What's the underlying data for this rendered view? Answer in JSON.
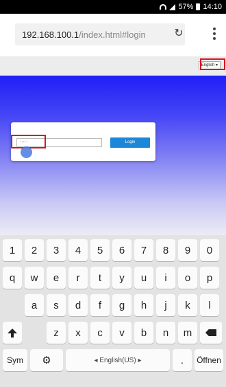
{
  "status_bar": {
    "battery": "57%",
    "time": "14:10"
  },
  "browser": {
    "url_host": "192.168.100.1",
    "url_path": "/index.html#login"
  },
  "page": {
    "language_select": "English ▾",
    "password_value": "·····",
    "login_label": "Login"
  },
  "keyboard": {
    "row1": [
      "1",
      "2",
      "3",
      "4",
      "5",
      "6",
      "7",
      "8",
      "9",
      "0"
    ],
    "row2": [
      "q",
      "w",
      "e",
      "r",
      "t",
      "y",
      "u",
      "i",
      "o",
      "p"
    ],
    "row3": [
      "a",
      "s",
      "d",
      "f",
      "g",
      "h",
      "j",
      "k",
      "l"
    ],
    "row4": [
      "z",
      "x",
      "c",
      "v",
      "b",
      "n",
      "m"
    ],
    "sym_label": "Sym",
    "space_label": "◂ English(US) ▸",
    "period_label": ".",
    "enter_label": "Öffnen"
  }
}
